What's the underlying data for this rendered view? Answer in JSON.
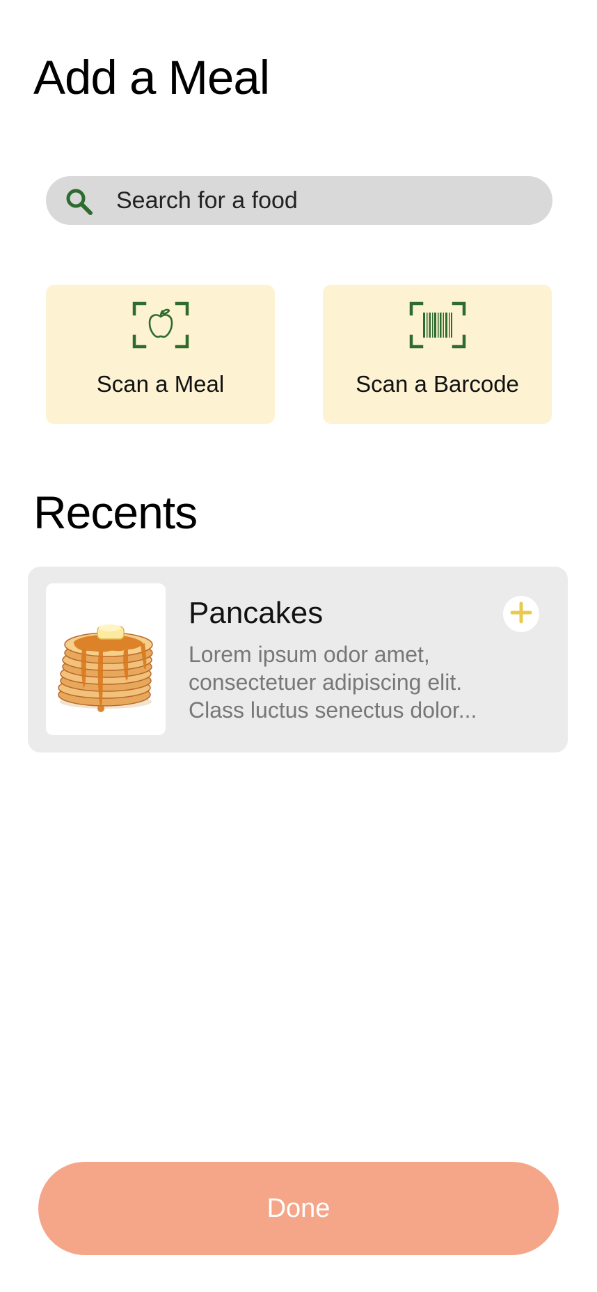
{
  "header": {
    "title": "Add a Meal"
  },
  "search": {
    "placeholder": "Search for a food",
    "icon": "search-icon"
  },
  "actions": [
    {
      "label": "Scan a Meal",
      "icon": "scan-apple-icon"
    },
    {
      "label": "Scan a Barcode",
      "icon": "scan-barcode-icon"
    }
  ],
  "recents": {
    "title": "Recents",
    "items": [
      {
        "name": "Pancakes",
        "description": "Lorem ipsum odor amet, consectetuer adipiscing elit. Class luctus senectus dolor...",
        "image": "pancakes-image",
        "add_icon": "plus-icon"
      }
    ]
  },
  "footer": {
    "done_label": "Done"
  },
  "colors": {
    "accent_green": "#2e6b2e",
    "card_yellow": "#fdf3d3",
    "plus_yellow": "#e9c94e",
    "done_button": "#f5a689",
    "search_bg": "#d9d9d9",
    "recent_card_bg": "#ebebeb"
  }
}
